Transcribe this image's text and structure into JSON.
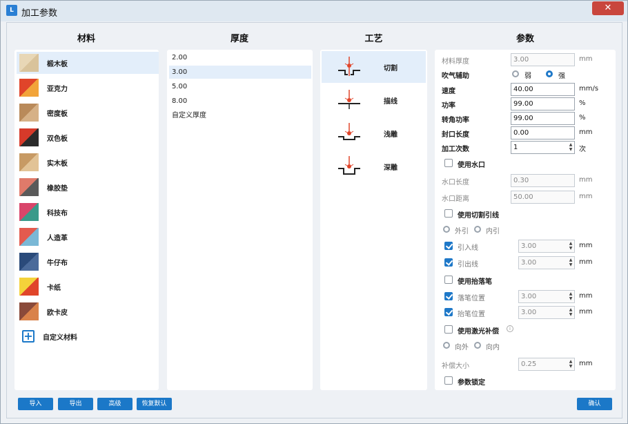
{
  "window": {
    "title": "加工参数",
    "close": "✕",
    "app_icon": "app-logo-icon"
  },
  "headers": {
    "materials": "材料",
    "thickness": "厚度",
    "process": "工艺",
    "params": "参数"
  },
  "materials": [
    {
      "label": "椴木板",
      "colors": [
        "#e8d7b6",
        "#d9c39b"
      ]
    },
    {
      "label": "亚克力",
      "colors": [
        "#e0452a",
        "#f2a43a"
      ]
    },
    {
      "label": "密度板",
      "colors": [
        "#b98a5a",
        "#d6b187"
      ]
    },
    {
      "label": "双色板",
      "colors": [
        "#d63a2a",
        "#2b2b2b"
      ]
    },
    {
      "label": "实木板",
      "colors": [
        "#c79a64",
        "#e2c396"
      ]
    },
    {
      "label": "橡胶垫",
      "colors": [
        "#e07a6a",
        "#5a5a5a"
      ]
    },
    {
      "label": "科技布",
      "colors": [
        "#d9456a",
        "#3a9a8a"
      ]
    },
    {
      "label": "人造革",
      "colors": [
        "#e35a4e",
        "#7ab8d6"
      ]
    },
    {
      "label": "牛仔布",
      "colors": [
        "#2a4a7a",
        "#4a6a9a"
      ]
    },
    {
      "label": "卡纸",
      "colors": [
        "#f4d23a",
        "#e0452a"
      ]
    },
    {
      "label": "欧卡皮",
      "colors": [
        "#8a4a3a",
        "#d9824a"
      ]
    }
  ],
  "custom_material": "自定义材料",
  "thickness": [
    "2.00",
    "3.00",
    "5.00",
    "8.00",
    "自定义厚度"
  ],
  "process": [
    {
      "label": "切割",
      "icon": "laser-cut-icon"
    },
    {
      "label": "描线",
      "icon": "laser-line-icon"
    },
    {
      "label": "浅雕",
      "icon": "laser-shallow-engrave-icon"
    },
    {
      "label": "深雕",
      "icon": "laser-deep-engrave-icon"
    }
  ],
  "params": {
    "material_thickness": {
      "label": "材料厚度",
      "value": "3.00",
      "unit": "mm"
    },
    "air_assist": {
      "label": "吹气辅助",
      "weak": "弱",
      "strong": "强"
    },
    "speed": {
      "label": "速度",
      "value": "40.00",
      "unit": "mm/s"
    },
    "power": {
      "label": "功率",
      "value": "99.00",
      "unit": "%"
    },
    "corner_power": {
      "label": "转角功率",
      "value": "99.00",
      "unit": "%"
    },
    "seal_length": {
      "label": "封口长度",
      "value": "0.00",
      "unit": "mm"
    },
    "passes": {
      "label": "加工次数",
      "value": "1",
      "unit": "次"
    },
    "use_gap": "使用水口",
    "gap_length": {
      "label": "水口长度",
      "value": "0.30",
      "unit": "mm"
    },
    "gap_distance": {
      "label": "水口距离",
      "value": "50.00",
      "unit": "mm"
    },
    "use_lead": "使用切割引线",
    "lead_outer": "外引",
    "lead_inner": "内引",
    "lead_in": {
      "label": "引入线",
      "value": "3.00",
      "unit": "mm"
    },
    "lead_out": {
      "label": "引出线",
      "value": "3.00",
      "unit": "mm"
    },
    "use_pen_lift": "使用抬落笔",
    "pen_down": {
      "label": "落笔位置",
      "value": "3.00",
      "unit": "mm"
    },
    "pen_up": {
      "label": "抬笔位置",
      "value": "3.00",
      "unit": "mm"
    },
    "use_comp": "使用激光补偿",
    "comp_out": "向外",
    "comp_in": "向内",
    "comp_size": {
      "label": "补偿大小",
      "value": "0.25",
      "unit": "mm"
    },
    "lock": "参数锁定"
  },
  "buttons": {
    "import": "导入",
    "export": "导出",
    "advanced": "高级",
    "restore": "恢复默认",
    "confirm": "确认"
  },
  "colors": {
    "accent": "#1b78c8",
    "selected": "#e3eefa"
  }
}
